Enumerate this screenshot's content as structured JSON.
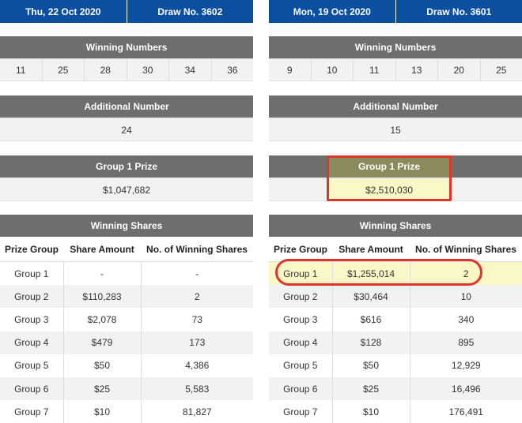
{
  "draws": [
    {
      "date": "Thu, 22 Oct 2020",
      "draw_no": "Draw No. 3602",
      "winning_numbers_label": "Winning Numbers",
      "winning_numbers": [
        "11",
        "25",
        "28",
        "30",
        "34",
        "36"
      ],
      "additional_label": "Additional Number",
      "additional_number": "24",
      "group1_label": "Group 1 Prize",
      "group1_prize": "$1,047,682",
      "shares_label": "Winning Shares",
      "columns": [
        "Prize Group",
        "Share Amount",
        "No. of Winning Shares"
      ],
      "rows": [
        [
          "Group 1",
          "-",
          "-"
        ],
        [
          "Group 2",
          "$110,283",
          "2"
        ],
        [
          "Group 3",
          "$2,078",
          "73"
        ],
        [
          "Group 4",
          "$479",
          "173"
        ],
        [
          "Group 5",
          "$50",
          "4,386"
        ],
        [
          "Group 6",
          "$25",
          "5,583"
        ],
        [
          "Group 7",
          "$10",
          "81,827"
        ]
      ]
    },
    {
      "date": "Mon, 19 Oct 2020",
      "draw_no": "Draw No. 3601",
      "winning_numbers_label": "Winning Numbers",
      "winning_numbers": [
        "9",
        "10",
        "11",
        "13",
        "20",
        "25"
      ],
      "additional_label": "Additional Number",
      "additional_number": "15",
      "group1_label": "Group 1 Prize",
      "group1_prize": "$2,510,030",
      "shares_label": "Winning Shares",
      "columns": [
        "Prize Group",
        "Share Amount",
        "No. of Winning Shares"
      ],
      "rows": [
        [
          "Group 1",
          "$1,255,014",
          "2"
        ],
        [
          "Group 2",
          "$30,464",
          "10"
        ],
        [
          "Group 3",
          "$616",
          "340"
        ],
        [
          "Group 4",
          "$128",
          "895"
        ],
        [
          "Group 5",
          "$50",
          "12,929"
        ],
        [
          "Group 6",
          "$25",
          "16,496"
        ],
        [
          "Group 7",
          "$10",
          "176,491"
        ]
      ]
    }
  ],
  "colors": {
    "header_blue": "#0a4fa0",
    "section_gray": "#6e6e6e",
    "highlight_yellow": "#fbf8c8",
    "annotation_red": "#e0342a"
  }
}
